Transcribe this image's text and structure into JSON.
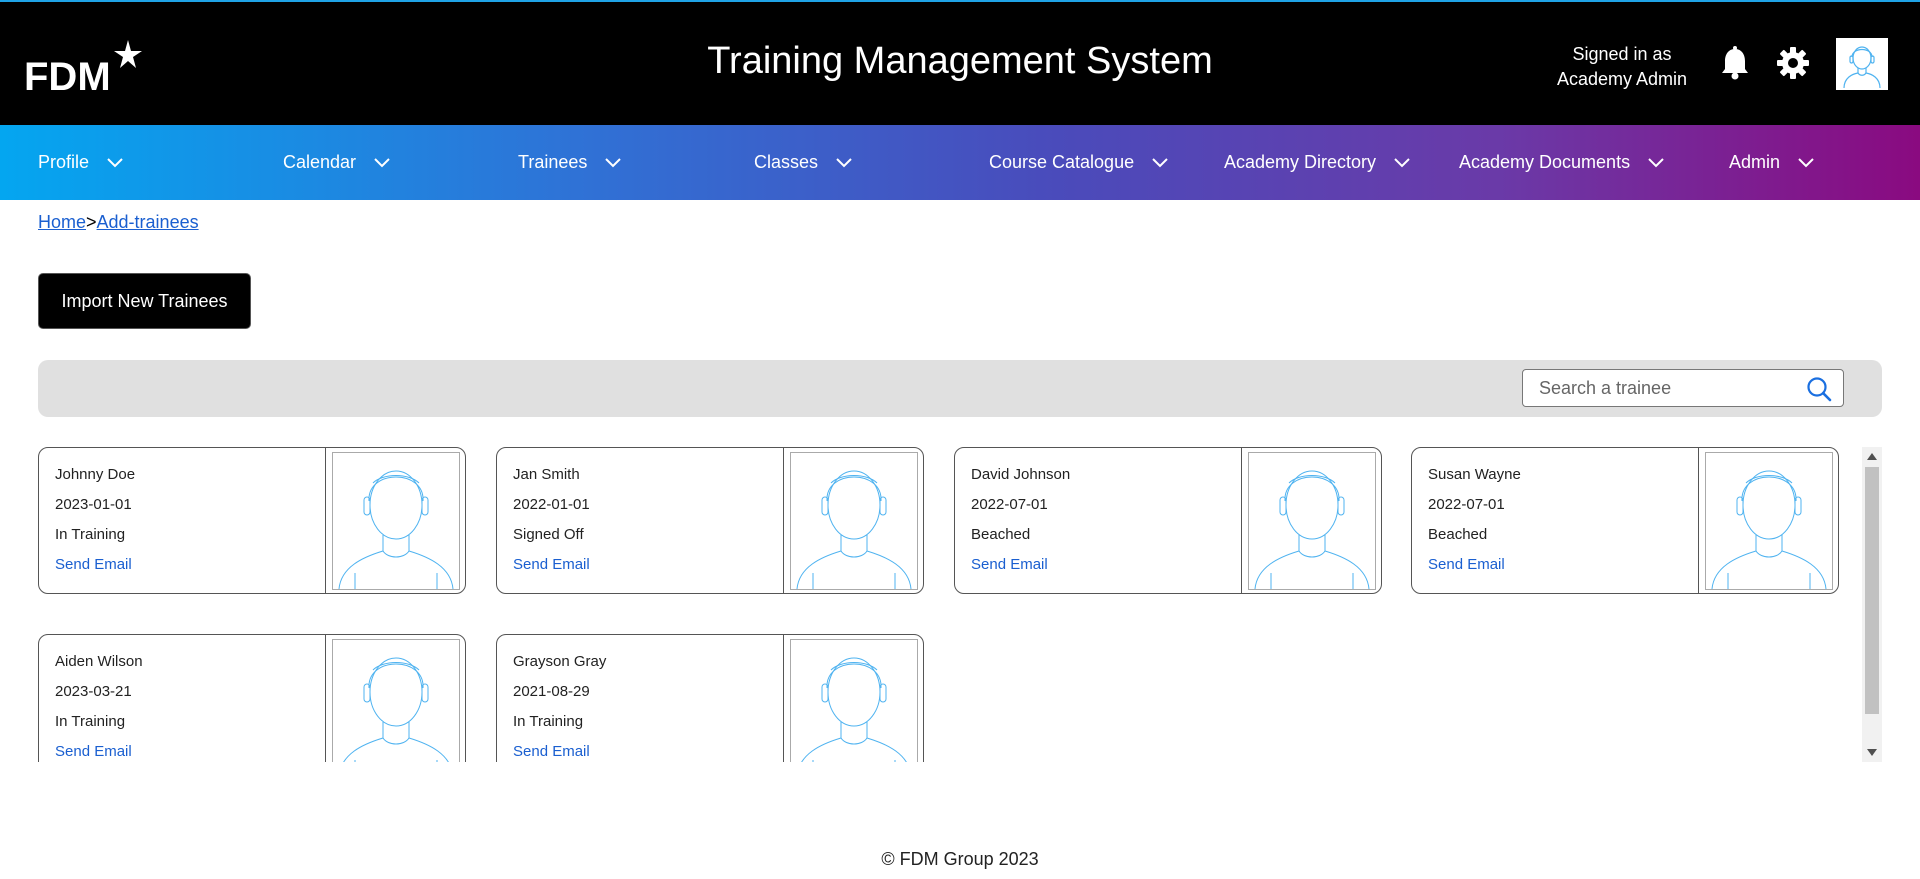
{
  "header": {
    "logo_text": "FDM",
    "title": "Training Management System",
    "signed_in_line1": "Signed in as",
    "signed_in_line2": "Academy Admin",
    "icons": [
      "bell-icon",
      "gear-icon",
      "avatar"
    ]
  },
  "nav": {
    "items": [
      {
        "label": "Profile"
      },
      {
        "label": "Calendar"
      },
      {
        "label": "Trainees"
      },
      {
        "label": "Classes"
      },
      {
        "label": "Course Catalogue"
      },
      {
        "label": "Academy Directory"
      },
      {
        "label": "Academy Documents"
      },
      {
        "label": "Admin"
      }
    ]
  },
  "breadcrumb": {
    "home": "Home",
    "separator": ">",
    "current": "Add-trainees"
  },
  "actions": {
    "import_label": "Import New Trainees"
  },
  "search": {
    "placeholder": "Search a trainee",
    "value": ""
  },
  "trainees": [
    {
      "name": "Johnny Doe",
      "date": "2023-01-01",
      "status": "In Training",
      "email_label": "Send Email"
    },
    {
      "name": "Jan Smith",
      "date": "2022-01-01",
      "status": "Signed Off",
      "email_label": "Send Email"
    },
    {
      "name": "David Johnson",
      "date": "2022-07-01",
      "status": "Beached",
      "email_label": "Send Email"
    },
    {
      "name": "Susan Wayne",
      "date": "2022-07-01",
      "status": "Beached",
      "email_label": "Send Email"
    },
    {
      "name": "Aiden Wilson",
      "date": "2023-03-21",
      "status": "In Training",
      "email_label": "Send Email"
    },
    {
      "name": "Grayson Gray",
      "date": "2021-08-29",
      "status": "In Training",
      "email_label": "Send Email"
    }
  ],
  "footer": {
    "copyright": "© FDM Group 2023"
  },
  "colors": {
    "header_bg": "#000000",
    "nav_start": "#04a6f0",
    "nav_end": "#8a0a80",
    "link": "#1a5fd0",
    "avatar_line": "#4fb3f0"
  }
}
